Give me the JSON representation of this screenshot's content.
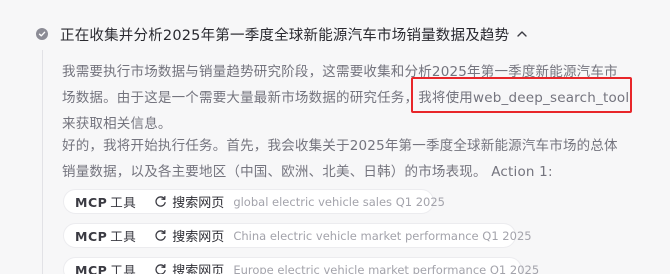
{
  "step": {
    "title": "正在收集并分析2025年第一季度全球新能源汽车市场销量数据及趋势"
  },
  "paragraph1": {
    "line1": "我需要执行市场数据与销量趋势研究阶段，这需要收集和分析2025年第一季度新能源汽车市",
    "line2": "场数据。由于这是一个需要大量最新市场数据的研究任务，我将使用web_deep_search_tool",
    "line3": "来获取相关信息。"
  },
  "paragraph2": {
    "line1": "好的，我将开始执行任务。首先，我会收集关于2025年第一季度全球新能源汽车市场的总体",
    "line2": "销量数据，以及各主要地区（中国、欧洲、北美、日韩）的市场表现。 Action 1:"
  },
  "tool_calls": [
    {
      "mcp": "MCP",
      "mcp_cn": "工具",
      "action": "搜索网页",
      "query": "global electric vehicle sales Q1 2025"
    },
    {
      "mcp": "MCP",
      "mcp_cn": "工具",
      "action": "搜索网页",
      "query": "China electric vehicle market performance Q1 2025"
    },
    {
      "mcp": "MCP",
      "mcp_cn": "工具",
      "action": "搜索网页",
      "query": "Europe electric vehicle market performance Q1 2025"
    }
  ],
  "icons": {
    "step_status": "check-circle-icon",
    "collapse": "chevron-up-icon",
    "search_action": "refresh-icon"
  },
  "colors": {
    "highlight": "#e8262a",
    "background": "#f7f7f8"
  }
}
